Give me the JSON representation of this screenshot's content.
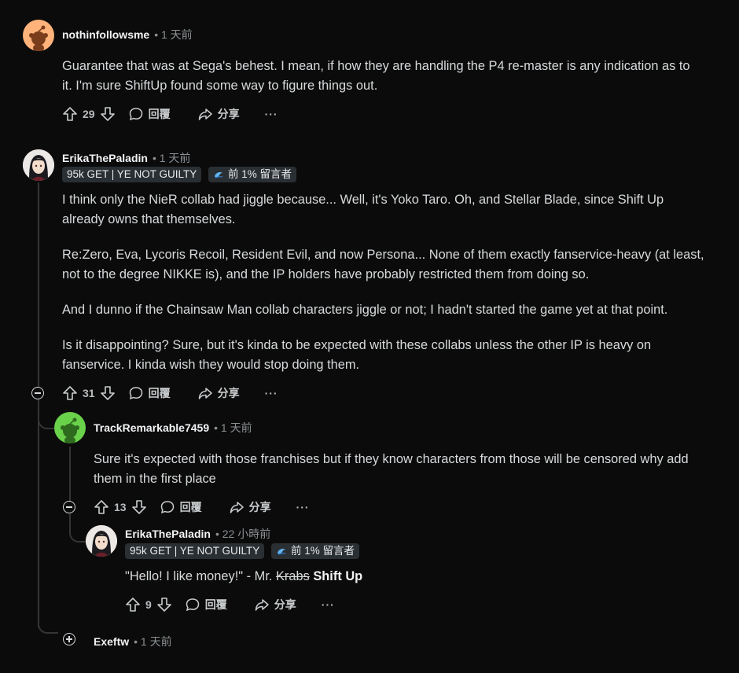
{
  "comments": [
    {
      "username": "nothinfollowsme",
      "time": "• 1 天前",
      "body": [
        "Guarantee that was at Sega's behest. I mean, if how they are handling the P4 re-master is any indication as to",
        "it. I'm sure ShiftUp found some way to figure things out."
      ],
      "votes": "29"
    },
    {
      "username": "ErikaThePaladin",
      "time": "• 1 天前",
      "flair": "95k GET | YE NOT GUILTY",
      "badge": "前 1% 留言者",
      "body": [
        "I think only the NieR collab had jiggle because... Well, it's Yoko Taro. Oh, and Stellar Blade, since Shift Up",
        "already owns that themselves.",
        "Re:Zero, Eva, Lycoris Recoil, Resident Evil, and now Persona... None of them exactly fanservice-heavy (at least,",
        "not to the degree NIKKE is), and the IP holders have probably restricted them from doing so.",
        "And I dunno if the Chainsaw Man collab characters jiggle or not; I hadn't started the game yet at that point.",
        "Is it disappointing? Sure, but it's kinda to be expected with these collabs unless the other IP is heavy on",
        "fanservice. I kinda wish they would stop doing them."
      ],
      "votes": "31"
    },
    {
      "username": "TrackRemarkable7459",
      "time": "• 1 天前",
      "body": [
        "Sure it's expected with those franchises but if they know characters from those will be censored why add",
        "them in the first place"
      ],
      "votes": "13"
    },
    {
      "username": "ErikaThePaladin",
      "time": "• 22 小時前",
      "flair": "95k GET | YE NOT GUILTY",
      "badge": "前 1% 留言者",
      "body_prefix": "\"Hello! I like money!\" - Mr. ",
      "body_strike": "Krabs",
      "body_bold": " Shift Up",
      "votes": "9"
    },
    {
      "username": "Exeftw",
      "time": "• 1 天前"
    }
  ],
  "actions": {
    "reply": "回覆",
    "share": "分享",
    "more": "···"
  },
  "icons": {
    "upvote": "upvote-icon",
    "downvote": "downvote-icon",
    "reply": "comment-bubble-icon",
    "share": "share-arrow-icon",
    "more": "more-dots-icon",
    "collapse": "collapse-minus-icon",
    "expand": "expand-plus-icon",
    "badge": "top-commenter-badge-icon"
  },
  "colors": {
    "background": "#0b0b0b",
    "snoo_orange": "#ffb37a",
    "snoo_green": "#6ad14a"
  }
}
